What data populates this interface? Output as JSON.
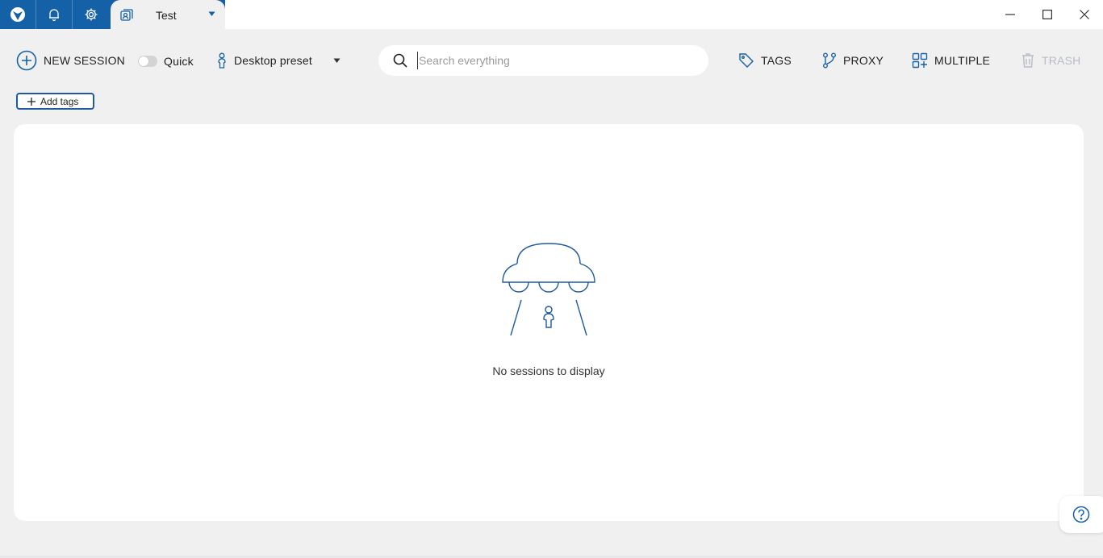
{
  "titlebar": {
    "tab": {
      "title": "Test"
    },
    "icons": [
      "app-logo-icon",
      "bell-icon",
      "gear-icon",
      "profiles-icon",
      "caret-down-icon"
    ],
    "window_controls": [
      "minimize-icon",
      "maximize-icon",
      "close-icon"
    ]
  },
  "toolbar": {
    "new_session_label": "NEW SESSION",
    "quick_label": "Quick",
    "quick_enabled": false,
    "preset_label": "Desktop preset",
    "search": {
      "placeholder": "Search everything",
      "value": ""
    },
    "tags_label": "TAGS",
    "proxy_label": "PROXY",
    "multiple_label": "MULTIPLE",
    "trash_label": "TRASH"
  },
  "add_tags_label": "Add tags",
  "empty_state": {
    "message": "No sessions to display",
    "icon": "ufo-icon"
  },
  "help": {
    "icon": "help-icon"
  },
  "colors": {
    "brand": "#1561a8",
    "accent": "#1f5aa0",
    "background": "#f0f0f1",
    "panel": "#ffffff",
    "disabled": "#b8bcc4"
  }
}
